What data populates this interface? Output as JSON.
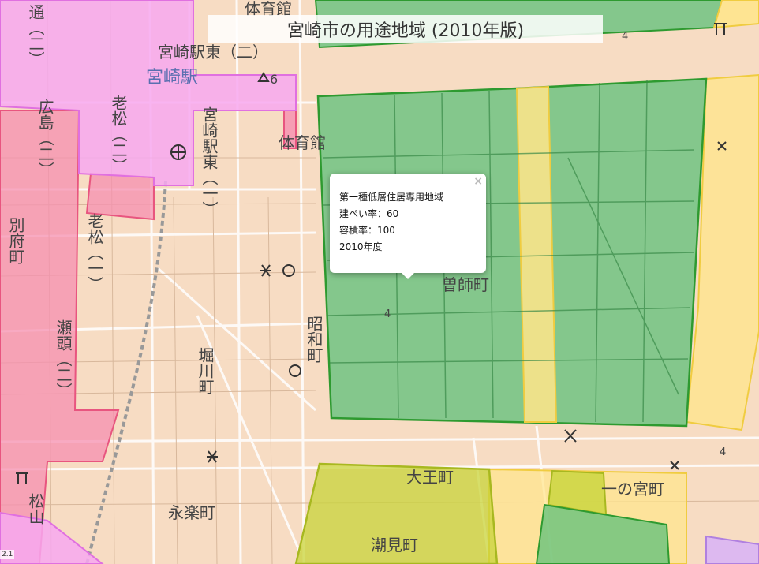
{
  "title": "宮崎市の用途地域 (2010年版)",
  "popup": {
    "close_glyph": "×",
    "zone": "第一種低層住居専用地域",
    "coverage": "建ぺい率：60",
    "floor_ratio": "容積率：100",
    "year": "2010年度"
  },
  "scale_label": "2.1",
  "map_labels": {
    "miyazaki_eki": "宮崎駅",
    "miyazaki_eki_higashi_2": "宮崎駅東（二）",
    "miyazaki_eki_higashi_1": "宮崎駅東（一）",
    "taiikukan_top": "体育館",
    "taiikukan": "体育館",
    "oimatsu_2": "老松（二）",
    "oimatsu_1": "老松（一）",
    "hiroshima_2": "広島（二）",
    "dori_2": "通（二）",
    "befu": "別府町",
    "setogashira_2": "瀬頭（二）",
    "matsuyama": "松山",
    "soshi": "曽師町",
    "showa": "昭和町",
    "horikawa": "堀川町",
    "eiraku": "永楽町",
    "oo": "大王町",
    "shiomi": "潮見町",
    "ichinomiya": "一の宮町",
    "spot_6": "6",
    "spot_4a": "4",
    "spot_4b": "4",
    "spot_4c": "4"
  },
  "zone_colors": {
    "low_rise_residential_1": "#5ec07a",
    "residential_1": "#ffe58a",
    "commercial": "#f58fb0",
    "neighborhood_commercial": "#f7a8f0",
    "semi_residential": "#c8d43a",
    "base": "#f7dcc3"
  }
}
